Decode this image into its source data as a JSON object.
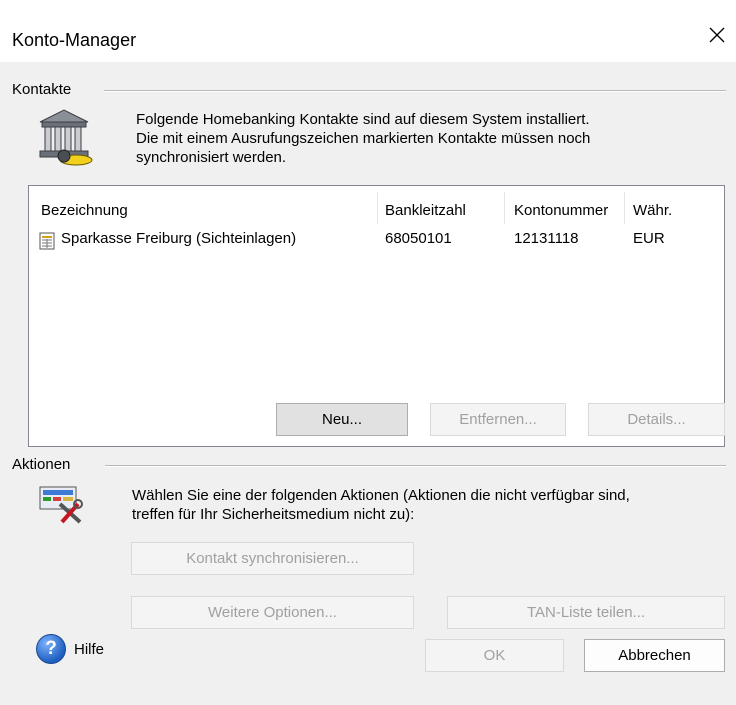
{
  "window": {
    "title": "Konto-Manager"
  },
  "contacts": {
    "group_label": "Kontakte",
    "description_line1": "Folgende Homebanking Kontakte sind auf diesem System installiert.",
    "description_line2": "Die mit einem Ausrufungszeichen markierten Kontakte müssen noch",
    "description_line3": "synchronisiert werden.",
    "columns": [
      "Bezeichnung",
      "Bankleitzahl",
      "Kontonummer",
      "Währ."
    ],
    "rows": [
      {
        "name": "Sparkasse Freiburg  (Sichteinlagen)",
        "blz": "68050101",
        "account": "12131118",
        "currency": "EUR"
      }
    ],
    "buttons": {
      "new": "Neu...",
      "remove": "Entfernen...",
      "details": "Details..."
    }
  },
  "actions": {
    "group_label": "Aktionen",
    "description_line1": "Wählen Sie eine der folgenden Aktionen (Aktionen die nicht verfügbar sind,",
    "description_line2": "treffen für Ihr Sicherheitsmedium nicht zu):",
    "buttons": {
      "sync": "Kontakt synchronisieren...",
      "more": "Weitere Optionen...",
      "tan": "TAN-Liste teilen..."
    }
  },
  "footer": {
    "help": "Hilfe",
    "ok": "OK",
    "cancel": "Abbrechen"
  },
  "icons": {
    "close": "close-icon",
    "bank": "bank-building-icon",
    "tools": "tools-icon",
    "help": "help-icon",
    "row": "document-icon"
  },
  "colors": {
    "dialog_bg": "#f0f0f0",
    "title_bg": "#ffffff",
    "help_blue": "#1f5fbf",
    "disabled_text": "#a0a0a0"
  }
}
